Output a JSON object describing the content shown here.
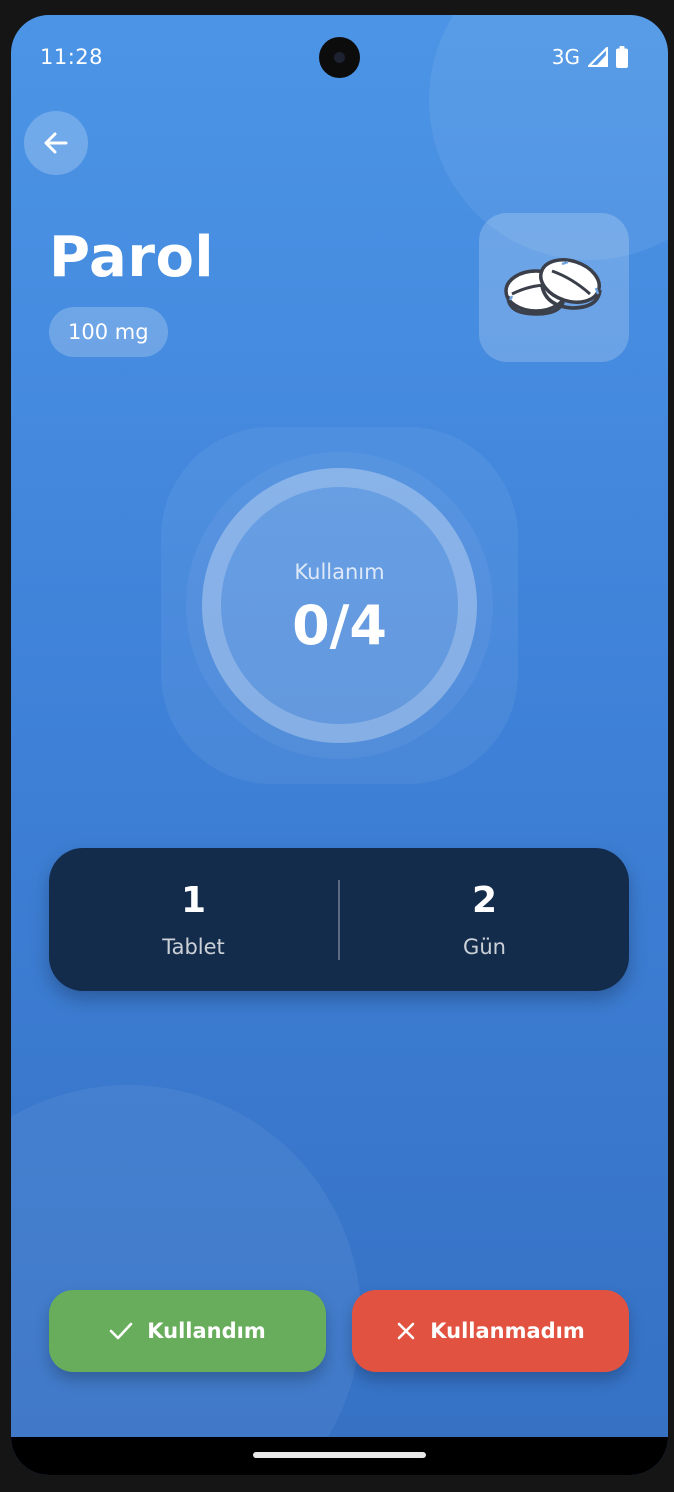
{
  "status_bar": {
    "time": "11:28",
    "network": "3G",
    "icons": [
      "signal-icon",
      "battery-icon"
    ]
  },
  "header": {
    "back_icon": "arrow-left-icon",
    "medication_name": "Parol",
    "dosage": "100 mg",
    "medication_icon": "pills-icon"
  },
  "usage": {
    "label": "Kullanım",
    "value": "0/4",
    "taken": 0,
    "total": 4
  },
  "stats": [
    {
      "value": "1",
      "label": "Tablet"
    },
    {
      "value": "2",
      "label": "Gün"
    }
  ],
  "actions": {
    "taken_label": "Kullandım",
    "taken_icon": "check-icon",
    "missed_label": "Kullanmadım",
    "missed_icon": "close-icon"
  },
  "colors": {
    "background_top": "#4c95e6",
    "background_bottom": "#3570c3",
    "card": "#142c4c",
    "taken": "#67ad5b",
    "missed": "#e25241"
  }
}
